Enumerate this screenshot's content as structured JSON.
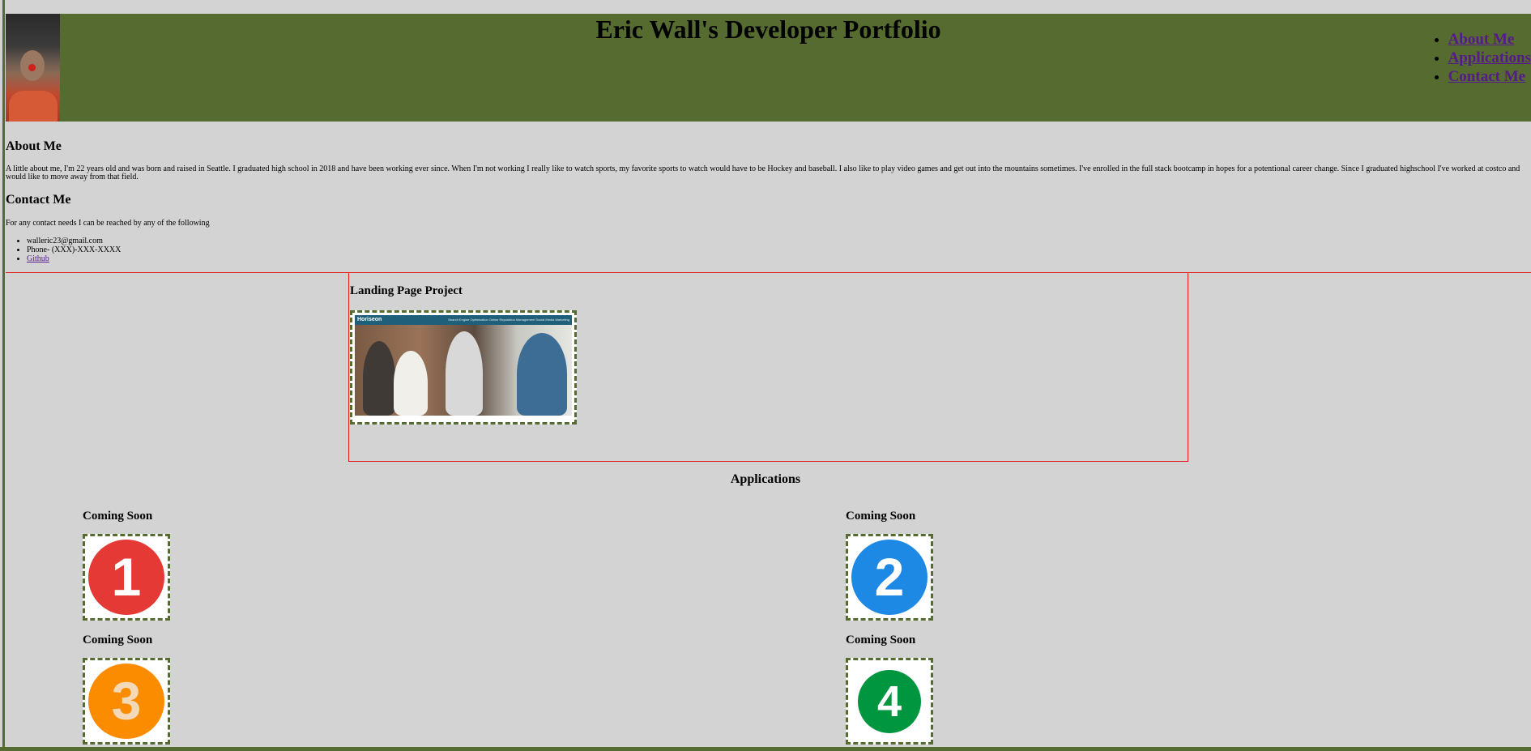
{
  "header": {
    "title": "Eric Wall's Developer Portfolio",
    "nav": [
      "About Me",
      "Applications",
      "Contact Me"
    ]
  },
  "about": {
    "heading": "About Me",
    "text": "A little about me, I'm 22 years old and was born and raised in Seattle. I graduated high school in 2018 and have been working ever since. When I'm not working I really like to watch sports, my favorite sports to watch would have to be Hockey and baseball. I also like to play video games and get out into the mountains sometimes. I've enrolled in the full stack bootcamp in hopes for a potentional career change. Since I graduated highschool I've worked at costco and would like to move away from that field."
  },
  "contact": {
    "heading": "Contact Me",
    "intro": "For any contact needs I can be reached by any of the following",
    "items": [
      "walleric23@gmail.com",
      "Phone- (XXX)-XXX-XXXX",
      "Github"
    ]
  },
  "project": {
    "title": "Landing Page Project",
    "screenshot_brand": "Horiseon",
    "screenshot_links": "Search Engine Optimization   Online Reputation Management   Social Media Marketing"
  },
  "applications": {
    "heading": "Applications",
    "items": [
      {
        "title": "Coming Soon",
        "number": "1",
        "color": "#e53935"
      },
      {
        "title": "Coming Soon",
        "number": "2",
        "color": "#1e88e5"
      },
      {
        "title": "Coming Soon",
        "number": "3",
        "color": "#fb8c00"
      },
      {
        "title": "Coming Soon",
        "number": "4",
        "color": "#00963f"
      }
    ]
  },
  "theme": {
    "header_bg": "#556b2f",
    "page_bg": "#d3d3d3",
    "accent_border": "#e01b1b",
    "link": "#551a8b"
  }
}
